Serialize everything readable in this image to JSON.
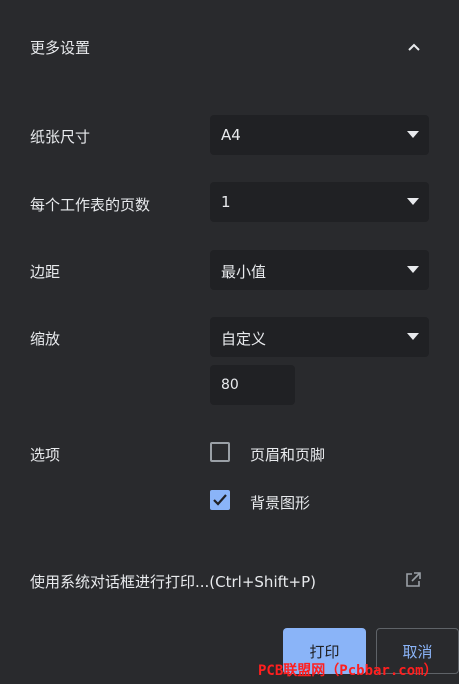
{
  "section": {
    "title": "更多设置"
  },
  "paper_size": {
    "label": "纸张尺寸",
    "value": "A4"
  },
  "pages_per_sheet": {
    "label": "每个工作表的页数",
    "value": "1"
  },
  "margins": {
    "label": "边距",
    "value": "最小值"
  },
  "scale": {
    "label": "缩放",
    "value": "自定义",
    "custom_value": "80"
  },
  "options": {
    "label": "选项",
    "items": [
      {
        "label": "页眉和页脚",
        "checked": false
      },
      {
        "label": "背景图形",
        "checked": true
      }
    ]
  },
  "system_dialog": {
    "label": "使用系统对话框进行打印...(Ctrl+Shift+P)"
  },
  "buttons": {
    "print": "打印",
    "cancel": "取消"
  },
  "watermark": "PCB联盟网（Pcbbar.com）",
  "colors": {
    "background": "#292a2d",
    "field": "#202124",
    "accent": "#8ab4f8",
    "text": "#e8eaed",
    "watermark": "#ff1f1f"
  }
}
